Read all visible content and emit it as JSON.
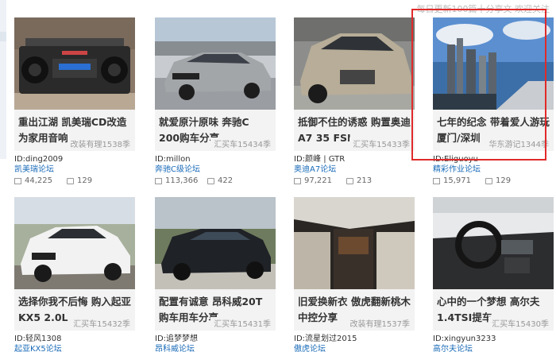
{
  "header": {
    "notice": "每日更新100篇十分享文 欢迎关注"
  },
  "cards": [
    {
      "title": "重出江湖 凯美瑞CD改造为家用音响",
      "tag": "改装有理1538季",
      "author": "ID:ding2009",
      "forum": "凯美瑞论坛",
      "views": "44,225",
      "comments": "129"
    },
    {
      "title": "就爱原汁原味 奔驰C 200购车分享",
      "tag": "汇买车15434季",
      "author": "ID:millon",
      "forum": "奔驰C级论坛",
      "views": "113,366",
      "comments": "422"
    },
    {
      "title": "抵御不住的诱惑 购置奥迪A7 35 FSI",
      "tag": "汇买车15433季",
      "author": "ID:颜峰 | GTR",
      "forum": "奥迪A7论坛",
      "views": "97,221",
      "comments": "213"
    },
    {
      "title": "七年的纪念 带着爱人游玩厦门/深圳",
      "tag": "华东游记1344季",
      "author": "ID:Eliguoyu",
      "forum": "精彩作业论坛",
      "views": "15,971",
      "comments": "129"
    },
    {
      "title": "选择你我不后悔 购入起亚KX5 2.0L",
      "tag": "汇买车15432季",
      "author": "ID:轻风1308",
      "forum": "起亚KX5论坛",
      "views": "",
      "comments": ""
    },
    {
      "title": "配置有诚意 昂科威20T购车用车分享",
      "tag": "汇买车15431季",
      "author": "ID:追梦梦想",
      "forum": "昂科威论坛",
      "views": "",
      "comments": ""
    },
    {
      "title": "旧爱换新衣 傲虎翻新桃木中控分享",
      "tag": "改装有理1537季",
      "author": "ID:流星划过2015",
      "forum": "傲虎论坛",
      "views": "",
      "comments": ""
    },
    {
      "title": "心中的一个梦想 高尔夫1.4TSI提车",
      "tag": "汇买车15430季",
      "author": "ID:xingyun3233",
      "forum": "高尔夫论坛",
      "views": "",
      "comments": ""
    }
  ]
}
